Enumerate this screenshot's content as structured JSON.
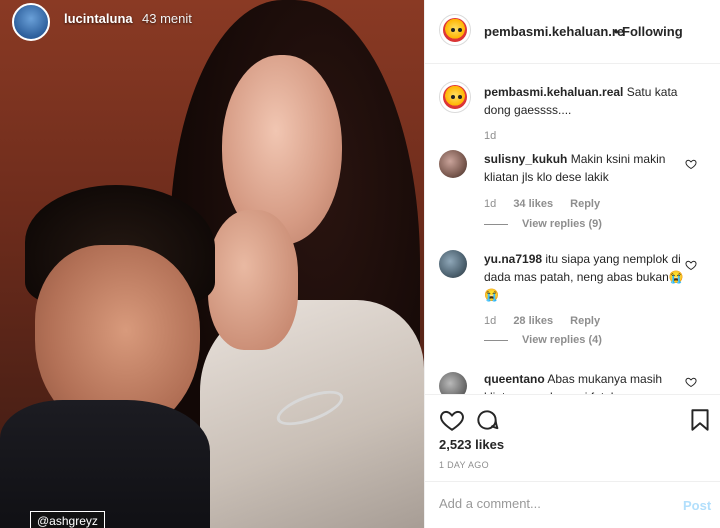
{
  "story": {
    "username": "lucintaluna",
    "time": "43 menit",
    "tag": "@ashgreyz"
  },
  "post": {
    "author": "pembasmi.kehaluan.real",
    "author_truncated": "pembasmi.kehaluan.re",
    "dot": "•",
    "follow_status": "Following",
    "caption": "Satu kata dong gaessss....",
    "caption_age": "1d",
    "likes": "2,523 likes",
    "date": "1 DAY AGO"
  },
  "comments": [
    {
      "user": "sulisny_kukuh",
      "text": "Makin ksini makin kliatan jls klo dese lakik",
      "age": "1d",
      "likes": "34 likes",
      "reply": "Reply",
      "replies": "View replies (9)"
    },
    {
      "user": "yu.na7198",
      "text": "itu siapa yang nemplok di dada mas patah, neng abas bukan😭😭",
      "age": "1d",
      "likes": "28 likes",
      "reply": "Reply",
      "replies": "View replies (4)"
    },
    {
      "user": "queentano",
      "text": "Abas mukanya masih kliatan cowoknya si fatah"
    }
  ],
  "composer": {
    "placeholder": "Add a comment...",
    "post_label": "Post"
  },
  "icons": {
    "like": "heart-icon",
    "comment": "comment-icon",
    "save": "bookmark-icon"
  },
  "colors": {
    "text": "#262626",
    "muted": "#8e8e8e",
    "post_disabled": "#b2dffc",
    "divider": "#efefef"
  }
}
